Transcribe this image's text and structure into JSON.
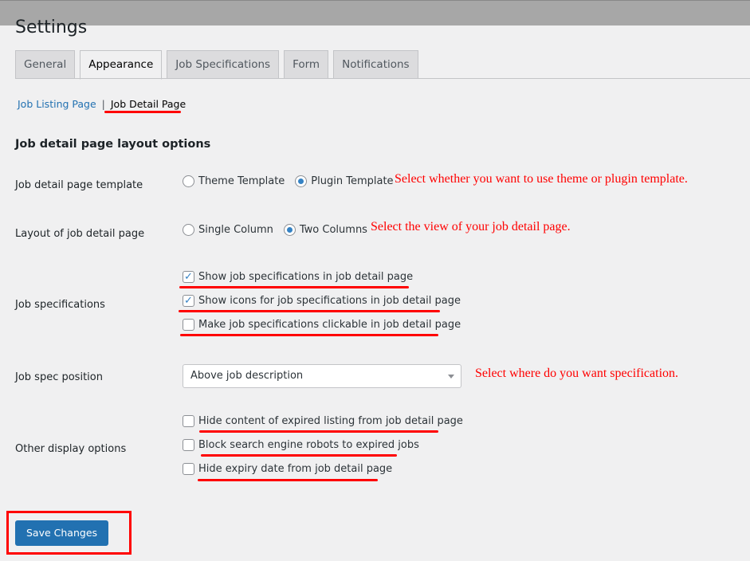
{
  "title": "Settings",
  "tabs": [
    {
      "label": "General"
    },
    {
      "label": "Appearance",
      "active": true
    },
    {
      "label": "Job Specifications"
    },
    {
      "label": "Form"
    },
    {
      "label": "Notifications"
    }
  ],
  "subnav": {
    "listing": "Job Listing Page",
    "sep": "|",
    "detail": "Job Detail Page"
  },
  "section_title": "Job detail page layout options",
  "template": {
    "label": "Job detail page template",
    "options": [
      "Theme Template",
      "Plugin Template"
    ],
    "selected": "Plugin Template",
    "note": "Select whether you want to use theme or plugin template."
  },
  "layout": {
    "label": "Layout of job detail page",
    "options": [
      "Single Column",
      "Two Columns"
    ],
    "selected": "Two Columns",
    "note": "Select the view of your job detail page."
  },
  "specs": {
    "label": "Job specifications",
    "items": [
      {
        "text": "Show job specifications in job detail page",
        "checked": true
      },
      {
        "text": "Show icons for job specifications in job detail page",
        "checked": true
      },
      {
        "text": "Make job specifications clickable in job detail page",
        "checked": false
      }
    ]
  },
  "position": {
    "label": "Job spec position",
    "value": "Above job description",
    "note": "Select where do you want specification."
  },
  "other": {
    "label": "Other display options",
    "items": [
      {
        "text": "Hide content of expired listing from job detail page",
        "checked": false
      },
      {
        "text": "Block search engine robots to expired jobs",
        "checked": false
      },
      {
        "text": "Hide expiry date from job detail page",
        "checked": false
      }
    ]
  },
  "save": "Save Changes",
  "colors": {
    "accent": "#2271b1",
    "annotation": "#ff0000"
  }
}
